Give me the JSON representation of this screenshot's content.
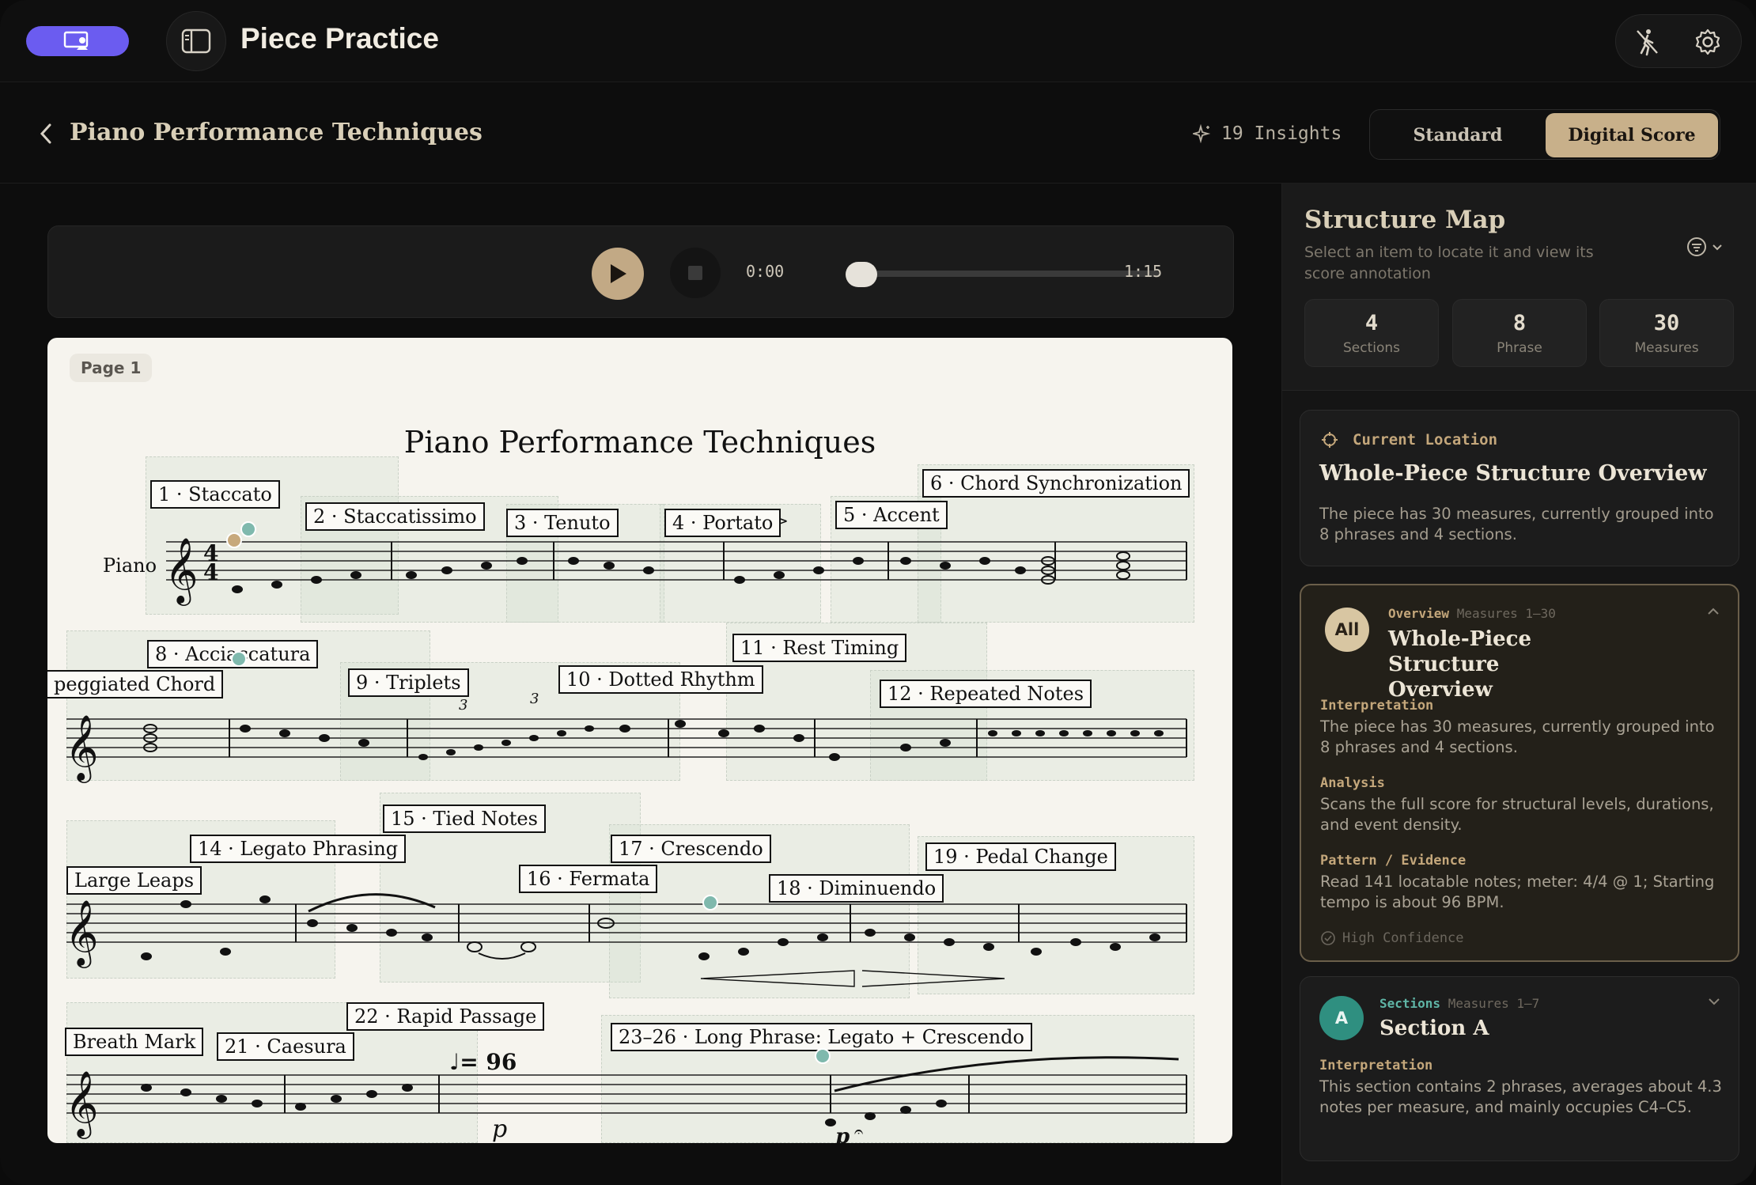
{
  "app": {
    "title": "Piece Practice"
  },
  "header": {
    "doc_title": "Piano Performance Techniques",
    "insights": "19 Insights",
    "modes": [
      "Standard",
      "Digital Score"
    ],
    "active_mode": "Digital Score"
  },
  "player": {
    "current": "0:00",
    "duration": "1:15",
    "progress": 0
  },
  "score": {
    "page_label": "Page 1",
    "title": "Piano Performance Techniques",
    "instrument": "Piano",
    "tempo_mark": "♩= 96",
    "labels": [
      "1 · Staccato",
      "2 · Staccatissimo",
      "3 · Tenuto",
      "4 · Portato",
      "5 · Accent",
      "6 · Chord Synchronization",
      "peggiated Chord",
      "8 · Acciaccatura",
      "9 · Triplets",
      "10 · Dotted Rhythm",
      "11 · Rest Timing",
      "12 · Repeated Notes",
      "Large Leaps",
      "14 · Legato Phrasing",
      "15 · Tied Notes",
      "16 · Fermata",
      "17 · Crescendo",
      "18 · Diminuendo",
      "19 · Pedal Change",
      "Breath Mark",
      "21 · Caesura",
      "22 · Rapid Passage",
      "23–26 · Long Phrase: Legato + Crescendo"
    ]
  },
  "panel": {
    "title": "Structure Map",
    "subtitle": "Select an item to locate it and view its score annotation",
    "stats": [
      {
        "value": "4",
        "label": "Sections"
      },
      {
        "value": "8",
        "label": "Phrase"
      },
      {
        "value": "30",
        "label": "Measures"
      }
    ],
    "current": {
      "heading": "Current Location",
      "title": "Whole-Piece Structure Overview",
      "text": "The piece has 30 measures, currently grouped into 8 phrases and 4 sections."
    },
    "overview": {
      "badge": "All",
      "kind": "Overview",
      "range": "Measures 1–30",
      "title": "Whole-Piece Structure Overview",
      "interp_label": "Interpretation",
      "interp": "The piece has 30 measures, currently grouped into 8 phrases and 4 sections.",
      "analysis_label": "Analysis",
      "analysis": "Scans the full score for structural levels, durations, and event density.",
      "pattern_label": "Pattern / Evidence",
      "pattern": "Read 141 locatable notes; meter: 4/4 @ 1; Starting tempo is about 96 BPM.",
      "confidence": "High Confidence"
    },
    "section_a": {
      "badge": "A",
      "kind": "Sections",
      "range": "Measures 1–7",
      "title": "Section A",
      "interp_label": "Interpretation",
      "interp": "This section contains 2 phrases, averages about 4.3 notes per measure, and mainly occupies C4–C5."
    }
  },
  "colors": {
    "accent": "#c8b08a",
    "purple": "#6b5cf0",
    "teal": "#2f8f80"
  }
}
